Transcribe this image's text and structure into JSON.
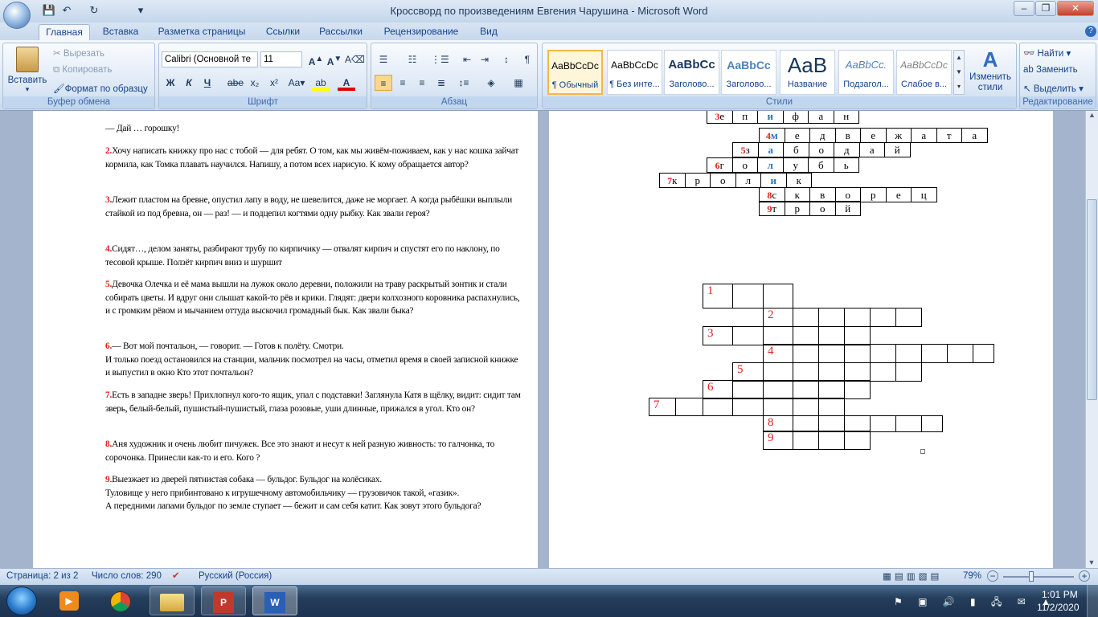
{
  "window": {
    "title": "Кроссворд  по произведениям Евгения Чарушина - Microsoft Word",
    "controls": {
      "minimize": "–",
      "restore": "❐",
      "close": "✕"
    }
  },
  "tabs": [
    "Главная",
    "Вставка",
    "Разметка страницы",
    "Ссылки",
    "Рассылки",
    "Рецензирование",
    "Вид"
  ],
  "clipboard": {
    "paste": "Вставить",
    "cut": "Вырезать",
    "copy": "Копировать",
    "format": "Формат по образцу",
    "label": "Буфер обмена"
  },
  "font": {
    "name": "Calibri (Основной те",
    "size": "11",
    "label": "Шрифт"
  },
  "paragraph": {
    "label": "Абзац"
  },
  "styles": {
    "label": "Стили",
    "items": [
      {
        "preview": "AaBbCcDc",
        "name": "¶ Обычный"
      },
      {
        "preview": "AaBbCcDc",
        "name": "¶ Без инте..."
      },
      {
        "preview": "AaBbCc",
        "name": "Заголово..."
      },
      {
        "preview": "AaBbCc",
        "name": "Заголово..."
      },
      {
        "preview": "AaB",
        "name": "Название"
      },
      {
        "preview": "AaBbCc.",
        "name": "Подзагол..."
      },
      {
        "preview": "AaBbCcDc",
        "name": "Слабое в..."
      }
    ],
    "change": "Изменить стили"
  },
  "editing": {
    "find": "Найти",
    "replace": "Заменить",
    "select": "Выделить",
    "label": "Редактирование"
  },
  "questions": {
    "q1_tail": "— Дай … горошку!",
    "q2": {
      "n": "2.",
      "text": "Хочу написать книжку про нас с тобой — для ребят. О том, как мы живём-поживаем, как у нас кошка зайчат кормила, как Томка плавать научился. Напишу, а потом всех нарисую. К кому обращается автор?"
    },
    "q3": {
      "n": "3.",
      "text": "Лежит пластом на бревне, опустил лапу в воду, не шевелится, даже не моргает. А когда рыбёшки выплыли стайкой из под бревна, он — раз! — и подцепил когтями одну рыбку. Как звали героя?"
    },
    "q4": {
      "n": "4.",
      "text": "Сидят…, делом заняты, разбирают трубу по кирпичику — отвалят кирпич и спустят его по наклону, по тесовой крыше. Ползёт кирпич вниз и шуршит"
    },
    "q5": {
      "n": "5.",
      "text": "Девочка Олечка и её мама вышли на лужок около деревни, положили на траву раскрытый зонтик и стали собирать цветы. И вдруг они слышат какой-то рёв и крики. Глядят: двери колхозного коровника распахнулись, и с громким рёвом и мычанием оттуда выскочил громадный бык. Как звали быка?"
    },
    "q6": {
      "n": "6.",
      "text": "— Вот мой почтальон, — говорит. — Готов к полёту. Смотри.",
      "text2": "И только поезд остановился на станции, мальчик посмотрел на часы, отметил время в своей записной книжке и выпустил в окно Кто этот почтальон?"
    },
    "q7": {
      "n": "7.",
      "text": "Есть в западне зверь! Прихлопнул кого-то ящик, упал с подставки! Заглянула Катя в щёлку, видит: сидит там зверь, белый-белый, пушистый-пушистый, глаза розовые,  уши длинные, прижался в угол. Кто он?"
    },
    "q8": {
      "n": "8.",
      "text": "Аня художник и очень любит пичужек. Все это знают и несут к ней разную живность: то галчонка, то сорочонка. Принесли как-то и его. Кого ?"
    },
    "q9": {
      "n": "9",
      "text": ".Выезжает из дверей пятнистая собака — бульдог. Бульдог на колёсиках.",
      "text2": "Туловище у него прибинтовано к игрушечному автомобильчику — грузовичок такой, «газик».",
      "text3": "А передними лапами бульдог по земле ступает — бежит и сам себя катит. Как зовут этого бульдога?"
    }
  },
  "solved": {
    "row3": {
      "n": "3",
      "cells": [
        "е",
        "п",
        "и",
        "ф",
        "а",
        "н"
      ]
    },
    "row4": {
      "n": "4",
      "cells": [
        "м",
        "е",
        "д",
        "в",
        "е",
        "ж",
        "а",
        "т",
        "а"
      ]
    },
    "row5": {
      "n": "5",
      "cells": [
        "з",
        "а",
        "б",
        "о",
        "д",
        "а",
        "й"
      ]
    },
    "row6": {
      "n": "6",
      "cells": [
        "г",
        "о",
        "л",
        "у",
        "б",
        "ь"
      ]
    },
    "row7": {
      "n": "7",
      "cells": [
        "к",
        "р",
        "о",
        "л",
        "и",
        "к"
      ]
    },
    "row8": {
      "n": "8",
      "cells": [
        "с",
        "к",
        "в",
        "о",
        "р",
        "е",
        "ц"
      ]
    },
    "row9": {
      "n": "9",
      "cells": [
        "т",
        "р",
        "о",
        "й"
      ]
    }
  },
  "blank_numbers": [
    "1",
    "2",
    "3",
    "4",
    "5",
    "6",
    "7",
    "8",
    "9"
  ],
  "status": {
    "page": "Страница: 2 из 2",
    "words": "Число слов: 290",
    "lang": "Русский (Россия)",
    "zoom": "79%"
  },
  "clock": {
    "time": "1:01 PM",
    "date": "11/2/2020"
  }
}
